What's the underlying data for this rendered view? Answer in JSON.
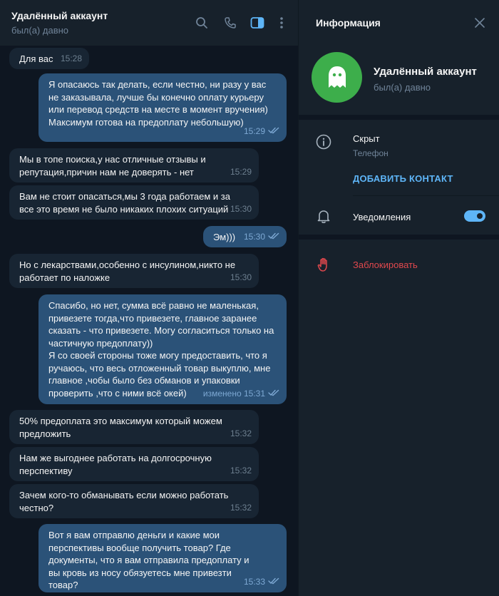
{
  "chat": {
    "title": "Удалённый аккаунт",
    "status": "был(а) давно"
  },
  "messages": [
    {
      "dir": "in",
      "text": "Для вас",
      "time": "15:28"
    },
    {
      "dir": "out",
      "text": "Я опасаюсь так делать, если честно, ни разу у вас не заказывала, лучше бы конечно оплату курьеру или перевод средств на месте в момент вручения) Максимум готова на предоплату небольшую)",
      "time": "15:29"
    },
    {
      "dir": "in",
      "text": "Мы в топе поиска,у нас отличные отзывы и репутация,причин нам не доверять - нет",
      "time": "15:29"
    },
    {
      "dir": "in",
      "text": "Вам не стоит опасаться,мы 3 года работаем и за все это время не было никаких плохих ситуаций",
      "time": "15:30"
    },
    {
      "dir": "out",
      "text": "Эм)))",
      "time": "15:30"
    },
    {
      "dir": "in",
      "text": "Но с лекарствами,особенно с инсулином,никто не работает по наложке",
      "time": "15:30"
    },
    {
      "dir": "out",
      "text": "Спасибо, но нет, сумма всё равно не маленькая, привезете тогда,что привезете, главное заранее сказать - что привезете. Могу согласиться только на частичную предоплату))\nЯ со своей стороны тоже могу предоставить, что я ручаюсь, что весь отложенный товар выкуплю, мне главное ,чобы было без обманов и упаковки проверить ,что с ними всё окей)",
      "time": "изменено 15:31"
    },
    {
      "dir": "in",
      "text": "50% предоплата это максимум который можем предложить",
      "time": "15:32"
    },
    {
      "dir": "in",
      "text": "Нам же выгоднее работать на долгосрочную перспективу",
      "time": "15:32"
    },
    {
      "dir": "in",
      "text": "Зачем кого-то обманывать если можно работать честно?",
      "time": "15:32"
    },
    {
      "dir": "out",
      "text": "Вот я вам отправлю деньги и какие мои перспективы вообще получить товар? Где документы, что я вам отправила предоплату и вы кровь из носу обязуетесь мне привезти товар?",
      "time": "15:33"
    }
  ],
  "info": {
    "title": "Информация",
    "name": "Удалённый аккаунт",
    "status": "был(а) давно",
    "phone_value": "Скрыт",
    "phone_label": "Телефон",
    "add_contact": "ДОБАВИТЬ КОНТАКТ",
    "notifications": "Уведомления",
    "notifications_on": true,
    "block": "Заблокировать"
  },
  "icons": {
    "search": "search-icon",
    "call": "phone-icon",
    "sidebar": "sidebar-toggle-icon",
    "more": "more-vertical-icon",
    "close": "close-icon",
    "avatar": "ghost-icon",
    "info": "info-icon",
    "bell": "bell-icon",
    "block": "hand-icon",
    "read": "double-check-icon"
  },
  "colors": {
    "accent": "#5eb5f7",
    "avatar": "#3dae4b",
    "danger": "#e0484d",
    "outgoing": "#2b5278",
    "incoming": "#182533"
  }
}
